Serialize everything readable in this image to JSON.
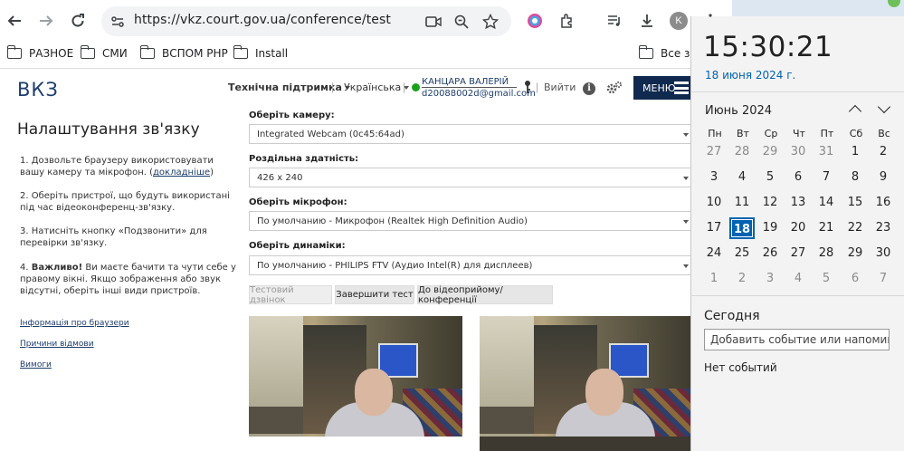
{
  "browser": {
    "url": "https://vkz.court.gov.ua/conference/test",
    "profile_initial": "K",
    "bookmarks": [
      "РАЗНОЕ",
      "СМИ",
      "ВСПОМ PHP",
      "Install",
      "Все зак"
    ]
  },
  "site": {
    "logo": "ВКЗ",
    "support": "Технічна підтримка",
    "language": "Українська",
    "user_name": "КАНЦАРА ВАЛЕРІЙ",
    "user_email": "d20088002d@gmail.com",
    "logout": "Вийти",
    "menu": "МЕНЮ"
  },
  "sidebar": {
    "title": "Налаштування зв'язку",
    "step1_a": "1. Дозвольте браузеру використовувати вашу камеру та мікрофон. (",
    "step1_link": "докладніше",
    "step1_b": ")",
    "step2": "2. Оберіть пристрої, що будуть використані під час відеоконференц-зв'язку.",
    "step3": "3. Натисніть кнопку «Подзвонити» для перевірки зв'язку.",
    "step4_bold": "Важливо!",
    "step4_num": "4.",
    "step4": " Ви маєте бачити та чути себе у правому вікні. Якщо зображення або звук відсутні, оберіть інші види пристроїв.",
    "links": [
      "Інформація про браузери",
      "Причини відмови",
      "Вимоги"
    ]
  },
  "form": {
    "camera_label": "Оберіть камеру:",
    "camera_value": "Integrated Webcam (0c45:64ad)",
    "resolution_label": "Роздільна здатність:",
    "resolution_value": "426 x 240",
    "mic_label": "Оберіть мікрофон:",
    "mic_value": "По умолчанию - Микрофон (Realtek High Definition Audio)",
    "speaker_label": "Оберіть динаміки:",
    "speaker_value": "По умолчанию - PHILIPS FTV (Аудио Intel(R) для дисплеев)",
    "btn_test_call": "Тестовий дзвінок",
    "btn_end_test": "Завершити тест",
    "btn_to_conference": "До відеоприйому/конференції"
  },
  "flyout": {
    "time": "15:30:21",
    "date": "18 июня 2024 г.",
    "month": "Июнь 2024",
    "weekdays": [
      "Пн",
      "Вт",
      "Ср",
      "Чт",
      "Пт",
      "Сб",
      "Вс"
    ],
    "weeks": [
      [
        "27",
        "28",
        "29",
        "30",
        "31",
        "1",
        "2"
      ],
      [
        "3",
        "4",
        "5",
        "6",
        "7",
        "8",
        "9"
      ],
      [
        "10",
        "11",
        "12",
        "13",
        "14",
        "15",
        "16"
      ],
      [
        "17",
        "18",
        "19",
        "20",
        "21",
        "22",
        "23"
      ],
      [
        "24",
        "25",
        "26",
        "27",
        "28",
        "29",
        "30"
      ],
      [
        "1",
        "2",
        "3",
        "4",
        "5",
        "6",
        "7"
      ]
    ],
    "today_label": "Сегодня",
    "event_placeholder": "Добавить событие или напоминание",
    "no_events": "Нет событий"
  },
  "colors": {
    "accent": "#0063b1",
    "brand": "#1c3d6e",
    "menu_bg": "#10294e"
  }
}
